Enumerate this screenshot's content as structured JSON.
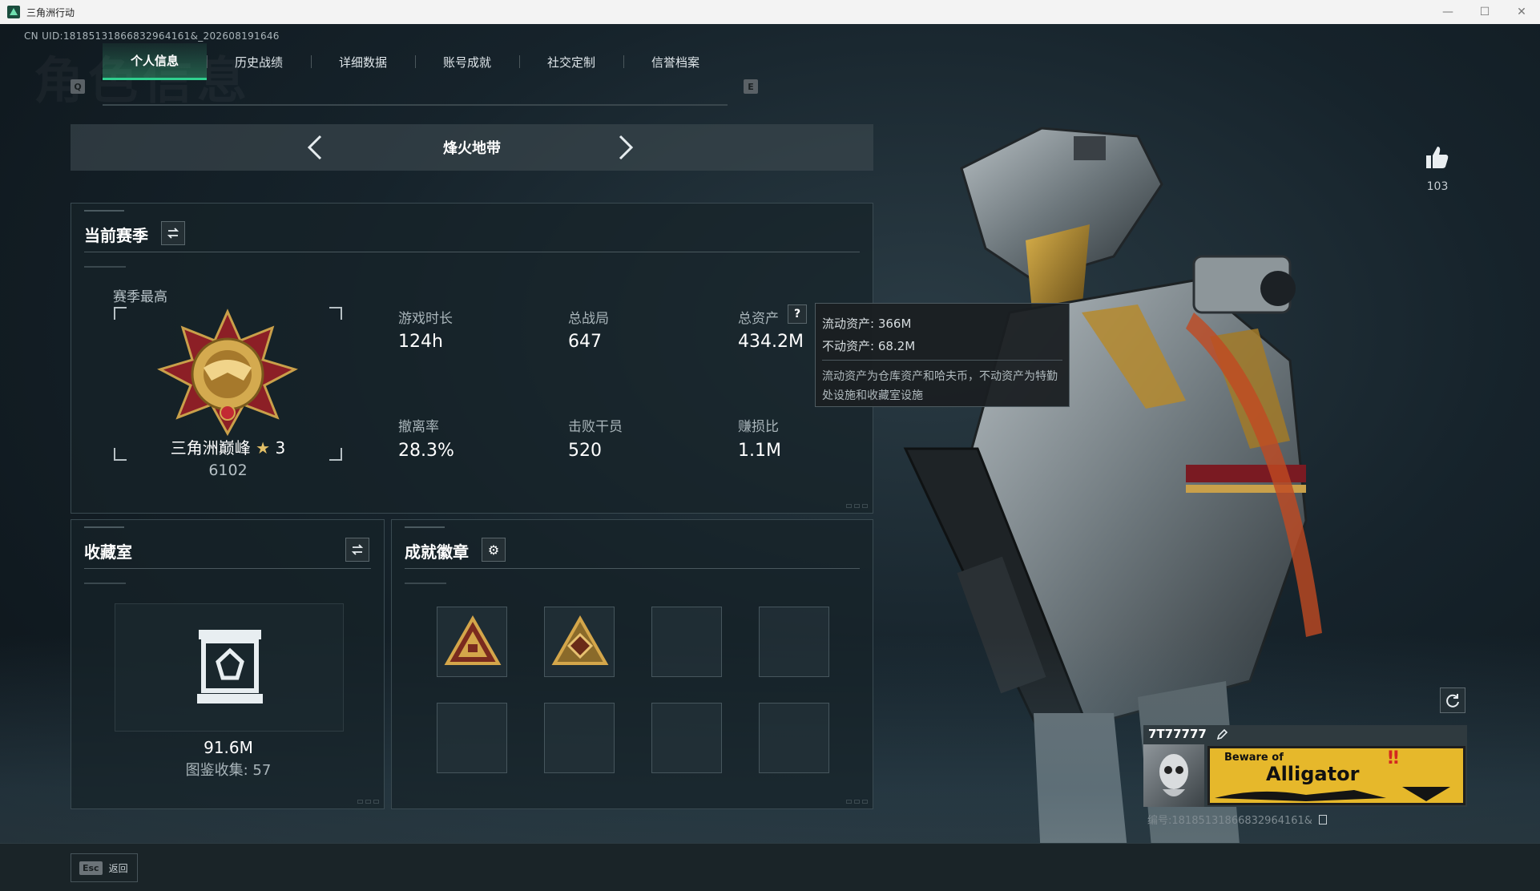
{
  "window": {
    "title": "三角洲行动",
    "controls": [
      "—",
      "☐",
      "✕"
    ]
  },
  "uid_text": "CN UID:18185131866832964161&_202608191646",
  "bg_watermark": "角色信息",
  "tabs": {
    "prev_key": "Q",
    "next_key": "E",
    "items": [
      "个人信息",
      "历史战绩",
      "详细数据",
      "账号成就",
      "社交定制",
      "信誉档案"
    ],
    "active_index": 0
  },
  "mode": {
    "name": "烽火地带"
  },
  "season": {
    "title": "当前赛季",
    "best_label": "赛季最高",
    "rank_name": "三角洲巅峰",
    "rank_stars": "3",
    "rank_score": "6102",
    "stats": [
      {
        "label": "游戏时长",
        "value": "124h"
      },
      {
        "label": "总战局",
        "value": "647"
      },
      {
        "label": "总资产",
        "value": "434.2M"
      },
      {
        "label": "撤离率",
        "value": "28.3%"
      },
      {
        "label": "击败干员",
        "value": "520"
      },
      {
        "label": "赚损比",
        "value": "1.1M"
      }
    ],
    "help_glyph": "?"
  },
  "tooltip": {
    "liquid": "流动资产: 366M",
    "fixed": "不动资产: 68.2M",
    "desc": "流动资产为仓库资产和哈夫币，不动资产为特勤处设施和收藏室设施"
  },
  "collection": {
    "title": "收藏室",
    "value": "91.6M",
    "count_text": "图鉴收集: 57"
  },
  "achievements": {
    "title": "成就徽章",
    "filled_slots": 2,
    "total_slots": 8
  },
  "player": {
    "likes": "103",
    "name": "7T77777",
    "banner_small": "Beware of",
    "banner_big": "Alligator",
    "banner_excl": "‼",
    "serial": "编号:18185131866832964161&"
  },
  "footer": {
    "esc_key": "Esc",
    "esc_label": "返回"
  },
  "colors": {
    "accent": "#2fd08f",
    "gold": "#c9a04a",
    "banner": "#e6b82b"
  }
}
